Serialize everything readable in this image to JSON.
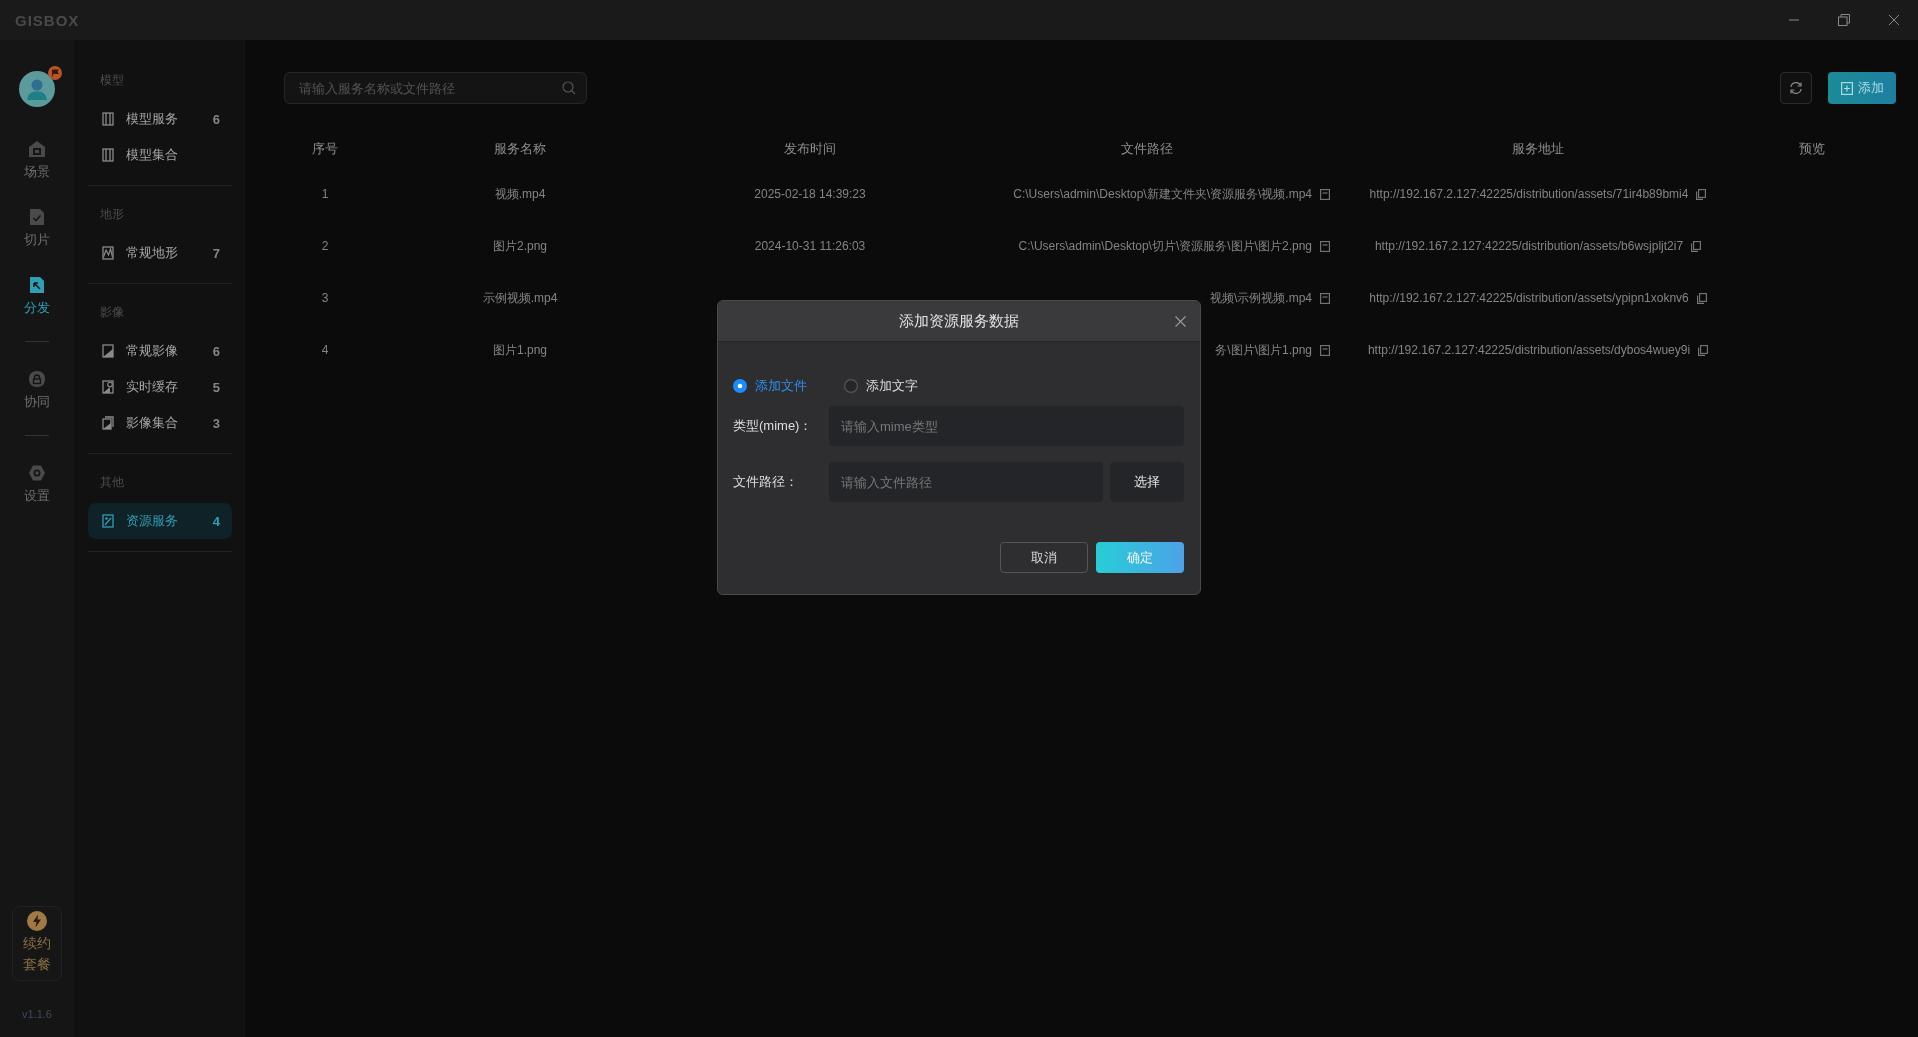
{
  "window": {
    "logo": "GISBOX"
  },
  "rail": {
    "groups": [
      [
        {
          "label": "场景",
          "selected": false
        },
        {
          "label": "切片",
          "selected": false
        },
        {
          "label": "分发",
          "selected": true
        }
      ],
      [
        {
          "label": "协同",
          "selected": false
        }
      ],
      [
        {
          "label": "设置",
          "selected": false
        }
      ]
    ],
    "renew": "续约套餐",
    "version": "v1.1.6"
  },
  "sidebar": {
    "sections": [
      {
        "title": "模型",
        "items": [
          {
            "label": "模型服务",
            "count": "6",
            "selected": false
          },
          {
            "label": "模型集合",
            "selected": false
          }
        ]
      },
      {
        "title": "地形",
        "items": [
          {
            "label": "常规地形",
            "count": "7",
            "selected": false
          }
        ]
      },
      {
        "title": "影像",
        "items": [
          {
            "label": "常规影像",
            "count": "6",
            "selected": false
          },
          {
            "label": "实时缓存",
            "count": "5",
            "selected": false
          },
          {
            "label": "影像集合",
            "count": "3",
            "selected": false
          }
        ]
      },
      {
        "title": "其他",
        "items": [
          {
            "label": "资源服务",
            "count": "4",
            "selected": true
          }
        ]
      }
    ]
  },
  "toolbar": {
    "search": {
      "placeholder": "请输入服务名称或文件路径"
    },
    "add_button": "添加"
  },
  "table": {
    "columns": [
      "序号",
      "服务名称",
      "发布时间",
      "文件路径",
      "服务地址",
      "预览"
    ],
    "rows": [
      {
        "index": "1",
        "name": "视频.mp4",
        "published": "2025-02-18 14:39:23",
        "file_path": "C:\\Users\\admin\\Desktop\\新建文件夹\\资源服务\\视频.mp4",
        "url": "http://192.167.2.127:42225/distribution/assets/71ir4b89bmi4"
      },
      {
        "index": "2",
        "name": "图片2.png",
        "published": "2024-10-31 11:26:03",
        "file_path": "C:\\Users\\admin\\Desktop\\切片\\资源服务\\图片\\图片2.png",
        "url": "http://192.167.2.127:42225/distribution/assets/b6wsjpljt2i7"
      },
      {
        "index": "3",
        "name": "示例视频.mp4",
        "file_path": "视频\\示例视频.mp4",
        "url": "http://192.167.2.127:42225/distribution/assets/ypipn1xoknv6"
      },
      {
        "index": "4",
        "name": "图片1.png",
        "file_path": "务\\图片\\图片1.png",
        "url": "http://192.167.2.127:42225/distribution/assets/dybos4wuey9i"
      }
    ]
  },
  "dialog": {
    "title": "添加资源服务数据",
    "modes": [
      {
        "label": "添加文件",
        "selected": true
      },
      {
        "label": "添加文字",
        "selected": false
      }
    ],
    "fields": [
      {
        "label": "类型(mime)：",
        "placeholder": "请输入mime类型"
      },
      {
        "label": "文件路径：",
        "placeholder": "请输入文件路径",
        "button": "选择"
      }
    ],
    "buttons": [
      {
        "label": "取消",
        "kind": "secondary"
      },
      {
        "label": "确定",
        "kind": "primary"
      }
    ]
  }
}
